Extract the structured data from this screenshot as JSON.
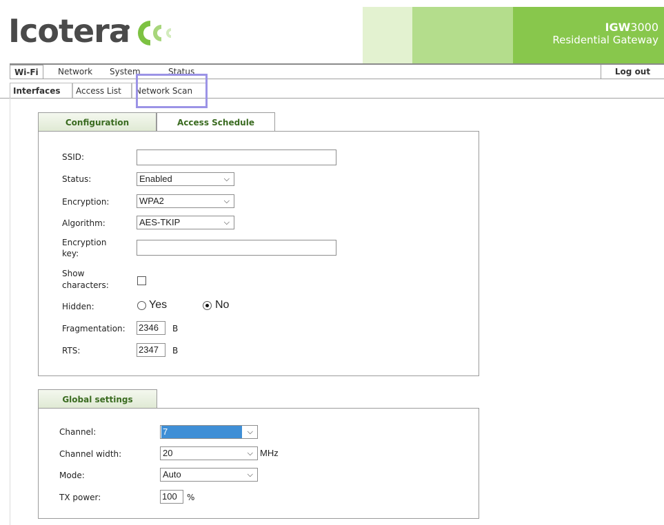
{
  "header": {
    "logo_text": "Icotera",
    "product_model_bold": "IGW",
    "product_model_num": "3000",
    "product_desc": "Residential Gateway",
    "colors": {
      "green_light": "#e3f2d0",
      "green_mid": "#b4dd8c",
      "green_dark": "#88c74c",
      "brand_grey": "#4a4a4a"
    }
  },
  "nav": {
    "tabs": [
      "Wi-Fi",
      "Network",
      "System",
      "Status"
    ],
    "logout": "Log out",
    "subtabs": [
      "Interfaces",
      "Access List",
      "Network Scan"
    ]
  },
  "config_panel": {
    "tabs": [
      "Configuration",
      "Access Schedule"
    ],
    "ssid_label": "SSID:",
    "ssid_value": "",
    "status_label": "Status:",
    "status_value": "Enabled",
    "encryption_label": "Encryption:",
    "encryption_value": "WPA2",
    "algorithm_label": "Algorithm:",
    "algorithm_value": "AES-TKIP",
    "key_label_1": "Encryption",
    "key_label_2": "key:",
    "key_value": "",
    "show_label_1": "Show",
    "show_label_2": "characters:",
    "hidden_label": "Hidden:",
    "hidden_yes": "Yes",
    "hidden_no": "No",
    "fragmentation_label": "Fragmentation:",
    "fragmentation_value": "2346",
    "fragmentation_unit": "B",
    "rts_label": "RTS:",
    "rts_value": "2347",
    "rts_unit": "B"
  },
  "global_panel": {
    "tab": "Global settings",
    "channel_label": "Channel:",
    "channel_value": "7",
    "width_label": "Channel width:",
    "width_value": "20",
    "width_unit": "MHz",
    "mode_label": "Mode:",
    "mode_value": "Auto",
    "tx_label": "TX power:",
    "tx_value": "100",
    "tx_unit": "%"
  }
}
